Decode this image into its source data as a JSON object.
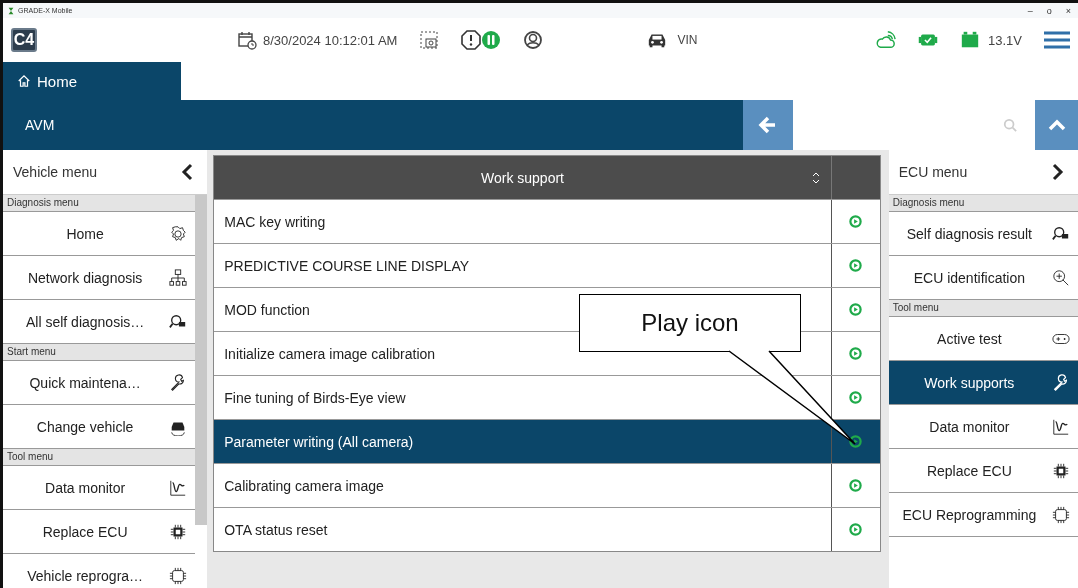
{
  "window": {
    "title": "GRADE-X Mobile",
    "controls": [
      "–",
      "o",
      "×"
    ]
  },
  "top_bar": {
    "logo": "C4",
    "datetime": "8/30/2024 10:12:01 AM",
    "vin": "VIN",
    "voltage": "13.1V"
  },
  "home_tab": {
    "label": "Home"
  },
  "breadcrumb": {
    "label": "AVM"
  },
  "vehicle_menu": {
    "title": "Vehicle menu",
    "sections": [
      {
        "label": "Diagnosis menu",
        "items": [
          {
            "label": "Home",
            "selected": false
          },
          {
            "label": "Network diagnosis",
            "selected": false
          },
          {
            "label": "All self diagnosis…",
            "selected": false
          }
        ]
      },
      {
        "label": "Start menu",
        "items": [
          {
            "label": "Quick maintena…",
            "selected": false
          },
          {
            "label": "Change vehicle",
            "selected": false
          }
        ]
      },
      {
        "label": "Tool menu",
        "items": [
          {
            "label": "Data monitor",
            "selected": false
          },
          {
            "label": "Replace ECU",
            "selected": false
          },
          {
            "label": "Vehicle reprogra…",
            "selected": false
          }
        ]
      }
    ]
  },
  "work_support": {
    "title": "Work support",
    "rows": [
      {
        "label": "MAC key writing",
        "selected": false
      },
      {
        "label": "PREDICTIVE COURSE LINE DISPLAY",
        "selected": false
      },
      {
        "label": "MOD function",
        "selected": false
      },
      {
        "label": "Initialize camera image calibration",
        "selected": false
      },
      {
        "label": "Fine tuning of Birds-Eye view",
        "selected": false
      },
      {
        "label": "Parameter writing (All camera)",
        "selected": true
      },
      {
        "label": "Calibrating camera image",
        "selected": false
      },
      {
        "label": "OTA status reset",
        "selected": false
      }
    ]
  },
  "ecu_menu": {
    "title": "ECU menu",
    "sections": [
      {
        "label": "Diagnosis menu",
        "items": [
          {
            "label": "Self diagnosis result",
            "selected": false
          },
          {
            "label": "ECU identification",
            "selected": false
          }
        ]
      },
      {
        "label": "Tool menu",
        "items": [
          {
            "label": "Active test",
            "selected": false
          },
          {
            "label": "Work supports",
            "selected": true
          },
          {
            "label": "Data monitor",
            "selected": false
          },
          {
            "label": "Replace ECU",
            "selected": false
          },
          {
            "label": "ECU Reprogramming",
            "selected": false
          }
        ]
      }
    ]
  },
  "callout": {
    "text": "Play icon"
  }
}
